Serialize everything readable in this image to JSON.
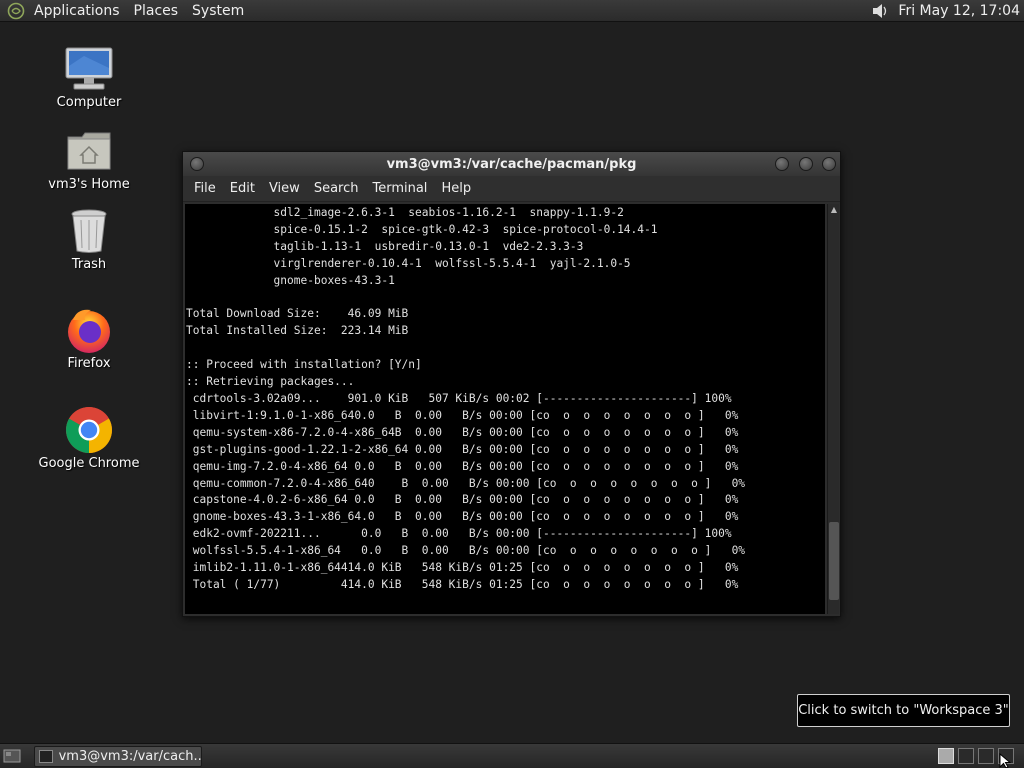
{
  "top_panel": {
    "menus": [
      "Applications",
      "Places",
      "System"
    ],
    "clock": "Fri May 12, 17:04"
  },
  "desktop_icons": [
    {
      "label": "Computer"
    },
    {
      "label": "vm3's Home"
    },
    {
      "label": "Trash"
    },
    {
      "label": "Firefox"
    },
    {
      "label": "Google Chrome"
    }
  ],
  "terminal": {
    "title": "vm3@vm3:/var/cache/pacman/pkg",
    "menus": [
      "File",
      "Edit",
      "View",
      "Search",
      "Terminal",
      "Help"
    ],
    "lines": [
      "             sdl2_image-2.6.3-1  seabios-1.16.2-1  snappy-1.1.9-2",
      "             spice-0.15.1-2  spice-gtk-0.42-3  spice-protocol-0.14.4-1",
      "             taglib-1.13-1  usbredir-0.13.0-1  vde2-2.3.3-3",
      "             virglrenderer-0.10.4-1  wolfssl-5.5.4-1  yajl-2.1.0-5",
      "             gnome-boxes-43.3-1",
      "",
      "Total Download Size:    46.09 MiB",
      "Total Installed Size:  223.14 MiB",
      "",
      ":: Proceed with installation? [Y/n]",
      ":: Retrieving packages...",
      " cdrtools-3.02a09...    901.0 KiB   507 KiB/s 00:02 [----------------------] 100%",
      " libvirt-1:9.1.0-1-x86_640.0   B  0.00   B/s 00:00 [co  o  o  o  o  o  o  o ]   0%",
      " qemu-system-x86-7.2.0-4-x86_64B  0.00   B/s 00:00 [co  o  o  o  o  o  o  o ]   0%",
      " gst-plugins-good-1.22.1-2-x86_64 0.00   B/s 00:00 [co  o  o  o  o  o  o  o ]   0%",
      " qemu-img-7.2.0-4-x86_64 0.0   B  0.00   B/s 00:00 [co  o  o  o  o  o  o  o ]   0%",
      " qemu-common-7.2.0-4-x86_640    B  0.00   B/s 00:00 [co  o  o  o  o  o  o  o ]   0%",
      " capstone-4.0.2-6-x86_64 0.0   B  0.00   B/s 00:00 [co  o  o  o  o  o  o  o ]   0%",
      " gnome-boxes-43.3-1-x86_64.0   B  0.00   B/s 00:00 [co  o  o  o  o  o  o  o ]   0%",
      " edk2-ovmf-202211...      0.0   B  0.00   B/s 00:00 [----------------------] 100%",
      " wolfssl-5.5.4-1-x86_64   0.0   B  0.00   B/s 00:00 [co  o  o  o  o  o  o  o ]   0%",
      " imlib2-1.11.0-1-x86_64414.0 KiB   548 KiB/s 01:25 [co  o  o  o  o  o  o  o ]   0%",
      " Total ( 1/77)         414.0 KiB   548 KiB/s 01:25 [co  o  o  o  o  o  o  o ]   0%"
    ]
  },
  "tooltip": "Click to switch to \"Workspace 3\"",
  "bottom_panel": {
    "task_label": "vm3@vm3:/var/cach..."
  },
  "colors": {
    "desktop_bg": "#1f1f1f",
    "terminal_bg": "#000000",
    "panel_bg": "#2b2b2b"
  }
}
